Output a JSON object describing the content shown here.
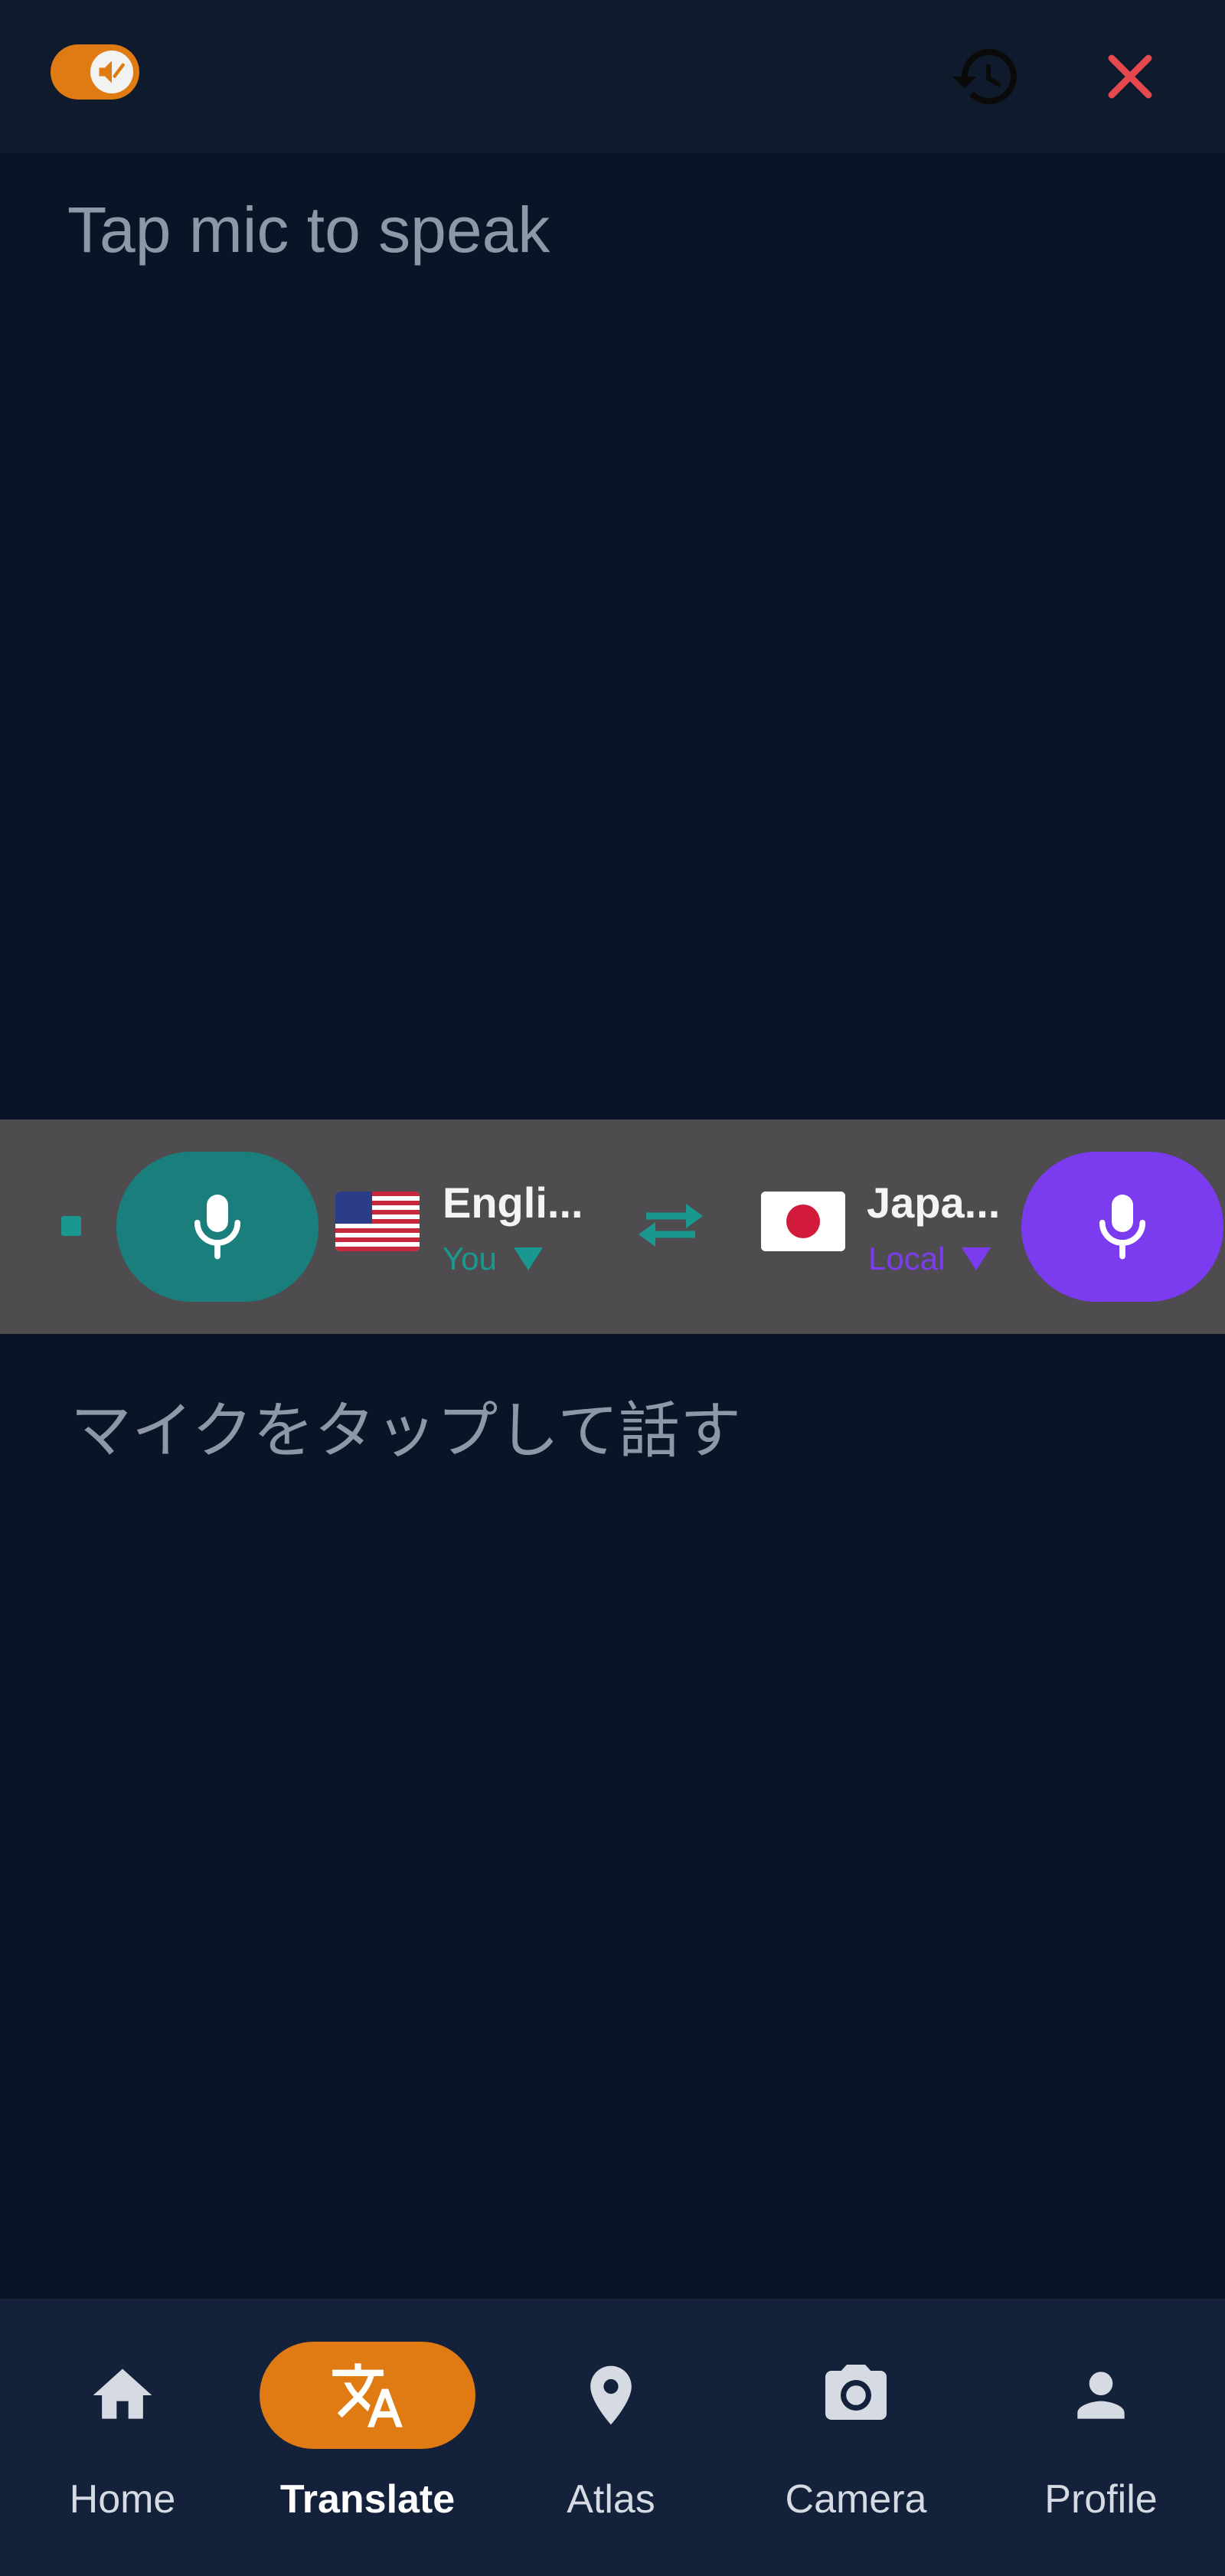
{
  "header": {
    "speaker_toggle_on": true,
    "history_icon": "history-icon",
    "close_icon": "close-icon"
  },
  "source_pane": {
    "placeholder": "Tap mic to speak"
  },
  "controls": {
    "you": {
      "language": "Engli...",
      "role": "You",
      "flag": "us-flag",
      "color": "#1a7f7c"
    },
    "swap_icon": "swap-arrows-icon",
    "local": {
      "language": "Japa...",
      "role": "Local",
      "flag": "japan-flag",
      "color": "#7b3cf0"
    }
  },
  "target_pane": {
    "placeholder": "マイクをタップして話す"
  },
  "bottom_nav": {
    "active": "Translate",
    "accent": "#e07b13",
    "items": [
      {
        "label": "Home",
        "icon": "home-icon"
      },
      {
        "label": "Translate",
        "icon": "translate-icon"
      },
      {
        "label": "Atlas",
        "icon": "location-pin-icon"
      },
      {
        "label": "Camera",
        "icon": "camera-icon"
      },
      {
        "label": "Profile",
        "icon": "person-icon"
      }
    ]
  }
}
